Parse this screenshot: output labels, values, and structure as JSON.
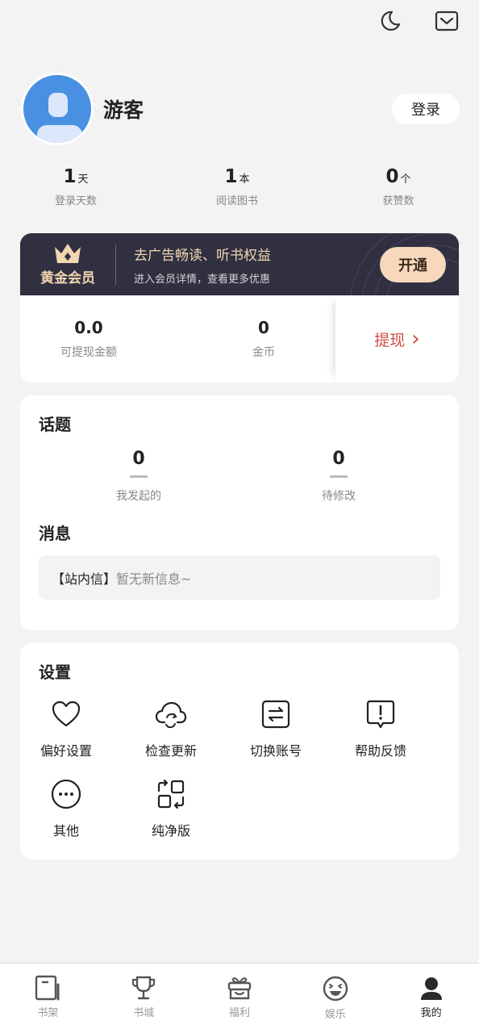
{
  "topbar": {
    "night_icon": "moon-icon",
    "message_icon": "mail-icon"
  },
  "profile": {
    "username": "游客",
    "login_label": "登录"
  },
  "stats": [
    {
      "value": "1",
      "unit": "天",
      "label": "登录天数"
    },
    {
      "value": "1",
      "unit": "本",
      "label": "阅读图书"
    },
    {
      "value": "0",
      "unit": "个",
      "label": "获赞数"
    }
  ],
  "vip": {
    "title": "黄金会员",
    "headline": "去广告畅读、听书权益",
    "subline": "进入会员详情，查看更多优惠",
    "open_label": "开通"
  },
  "wallet": {
    "balance_value": "0.0",
    "balance_label": "可提现金额",
    "coins_value": "0",
    "coins_label": "金币",
    "withdraw_label": "提现",
    "withdraw_arrow": "›"
  },
  "topics": {
    "title": "话题",
    "started_value": "0",
    "started_label": "我发起的",
    "pending_value": "0",
    "pending_label": "待修改"
  },
  "messages": {
    "title": "消息",
    "tag": "【站内信】",
    "text": "暂无新信息~"
  },
  "settings": {
    "title": "设置",
    "items": [
      {
        "label": "偏好设置",
        "icon": "heart-icon"
      },
      {
        "label": "检查更新",
        "icon": "cloud-sync-icon"
      },
      {
        "label": "切换账号",
        "icon": "switch-account-icon"
      },
      {
        "label": "帮助反馈",
        "icon": "feedback-icon"
      },
      {
        "label": "其他",
        "icon": "more-icon"
      },
      {
        "label": "纯净版",
        "icon": "pure-mode-icon"
      }
    ]
  },
  "tabs": [
    {
      "label": "书架",
      "icon": "bookshelf-icon",
      "active": false
    },
    {
      "label": "书城",
      "icon": "trophy-icon",
      "active": false
    },
    {
      "label": "福利",
      "icon": "gift-icon",
      "active": false
    },
    {
      "label": "娱乐",
      "icon": "smile-icon",
      "active": false
    },
    {
      "label": "我的",
      "icon": "user-icon",
      "active": true
    }
  ],
  "colors": {
    "vip_bg": "#303041",
    "vip_gold": "#f1d6b0",
    "withdraw_red": "#d14c47",
    "avatar_blue": "#4a90e2"
  }
}
